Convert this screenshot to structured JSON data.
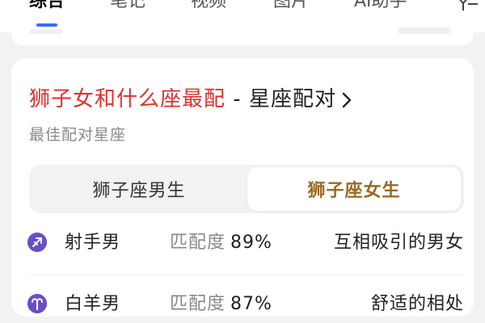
{
  "tabs": [
    {
      "label": "综合",
      "active": true
    },
    {
      "label": "笔记",
      "active": false
    },
    {
      "label": "视频",
      "active": false
    },
    {
      "label": "图片",
      "active": false
    },
    {
      "label": "AI助手",
      "active": false
    }
  ],
  "card": {
    "title_main": "狮子女和什么座最配",
    "title_sep": " - ",
    "title_suffix": "星座配对",
    "subtitle": "最佳配对星座",
    "segments": {
      "left": "狮子座男生",
      "right": "狮子座女生",
      "selected": "right"
    },
    "score_label": "匹配度",
    "rows": [
      {
        "icon": "sagittarius-icon",
        "name": "射手男",
        "score": "89%",
        "desc": "互相吸引的男女"
      },
      {
        "icon": "aries-icon",
        "name": "白羊男",
        "score": "87%",
        "desc": "舒适的相处"
      }
    ]
  },
  "colors": {
    "accent_blue": "#3570f5",
    "title_red": "#e0302c",
    "selected_segment_text": "#9b6a23",
    "zodiac_icon_bg": "#6a4ec7"
  }
}
